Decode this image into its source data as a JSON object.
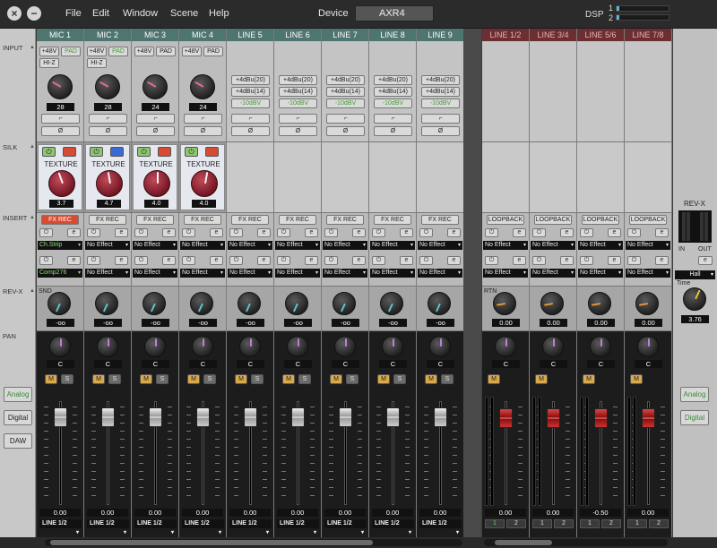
{
  "menu": [
    "File",
    "Edit",
    "Window",
    "Scene",
    "Help"
  ],
  "device": {
    "label": "Device",
    "value": "AXR4"
  },
  "dsp": {
    "label": "DSP",
    "rows": [
      {
        "num": "1",
        "fill": 0.05
      },
      {
        "num": "2",
        "fill": 0.05
      }
    ]
  },
  "sections": {
    "input": "INPUT",
    "silk": "SILK",
    "insert": "INSERT",
    "revx": "REV-X",
    "pan": "PAN"
  },
  "side_buttons": [
    "Analog",
    "Digital",
    "DAW"
  ],
  "right_buttons": [
    "Analog",
    "Digital"
  ],
  "colors": {
    "header_green": "#4e7570",
    "header_red": "#6b2e32",
    "fx_rec_active": "#d64b32",
    "mute_on": "#d9a94c"
  },
  "mic": [
    {
      "name": "MIC 1",
      "phantom": "+48V",
      "pad": "PAD",
      "hiz": "HI-Z",
      "gain": "28",
      "silk_tex": "TEXTURE",
      "silk_val": "3.7",
      "silk_blue": false,
      "fxrec": "FX REC",
      "fxrec_active": true,
      "fx1": "Ch.Strip",
      "fx2": "Comp276",
      "send": "-oo",
      "pan": "C",
      "out": "LINE 1/2"
    },
    {
      "name": "MIC 2",
      "phantom": "+48V",
      "pad": "PAD",
      "hiz": "HI-Z",
      "gain": "28",
      "silk_tex": "TEXTURE",
      "silk_val": "4.7",
      "silk_blue": true,
      "fxrec": "FX REC",
      "fxrec_active": false,
      "fx1": "No Effect",
      "fx2": "No Effect",
      "send": "-oo",
      "pan": "C",
      "out": "LINE 1/2"
    },
    {
      "name": "MIC 3",
      "phantom": "+48V",
      "pad": "PAD",
      "hiz": "",
      "gain": "24",
      "silk_tex": "TEXTURE",
      "silk_val": "4.0",
      "silk_blue": false,
      "fxrec": "FX REC",
      "fxrec_active": false,
      "fx1": "No Effect",
      "fx2": "No Effect",
      "send": "-oo",
      "pan": "C",
      "out": "LINE 1/2"
    },
    {
      "name": "MIC 4",
      "phantom": "+48V",
      "pad": "PAD",
      "hiz": "",
      "gain": "24",
      "silk_tex": "TEXTURE",
      "silk_val": "4.0",
      "silk_blue": false,
      "fxrec": "FX REC",
      "fxrec_active": false,
      "fx1": "No Effect",
      "fx2": "No Effect",
      "send": "-oo",
      "pan": "C",
      "out": "LINE 1/2"
    }
  ],
  "line": [
    {
      "name": "LINE 5",
      "lvl1": "+4dBu(20)",
      "lvl2": "+4dBu(14)",
      "lvl3": "-10dBV",
      "fxrec": "FX REC",
      "fx1": "No Effect",
      "fx2": "No Effect",
      "send": "-oo",
      "pan": "C",
      "out": "LINE 1/2"
    },
    {
      "name": "LINE 6",
      "lvl1": "+4dBu(20)",
      "lvl2": "+4dBu(14)",
      "lvl3": "-10dBV",
      "fxrec": "FX REC",
      "fx1": "No Effect",
      "fx2": "No Effect",
      "send": "-oo",
      "pan": "C",
      "out": "LINE 1/2"
    },
    {
      "name": "LINE 7",
      "lvl1": "+4dBu(20)",
      "lvl2": "+4dBu(14)",
      "lvl3": "-10dBV",
      "fxrec": "FX REC",
      "fx1": "No Effect",
      "fx2": "No Effect",
      "send": "-oo",
      "pan": "C",
      "out": "LINE 1/2"
    },
    {
      "name": "LINE 8",
      "lvl1": "+4dBu(20)",
      "lvl2": "+4dBu(14)",
      "lvl3": "-10dBV",
      "fxrec": "FX REC",
      "fx1": "No Effect",
      "fx2": "No Effect",
      "send": "-oo",
      "pan": "C",
      "out": "LINE 1/2"
    },
    {
      "name": "LINE 9",
      "lvl1": "+4dBu(20)",
      "lvl2": "+4dBu(14)",
      "lvl3": "-10dBV",
      "fxrec": "FX REC",
      "fx1": "No Effect",
      "fx2": "No Effect",
      "send": "-oo",
      "pan": "C",
      "out": "LINE 1/2"
    }
  ],
  "stereo": [
    {
      "name": "LINE 1/2",
      "loop": "LOOPBACK",
      "fx1": "No Effect",
      "fx2": "No Effect",
      "rtn": "0.00",
      "pan": "C",
      "fader": "0.00",
      "hp1": "1",
      "hp2": "2",
      "hp1_on": true
    },
    {
      "name": "LINE 3/4",
      "loop": "LOOPBACK",
      "fx1": "No Effect",
      "fx2": "No Effect",
      "rtn": "0.00",
      "pan": "C",
      "fader": "0.00",
      "hp1": "1",
      "hp2": "2",
      "hp1_on": false
    },
    {
      "name": "LINE 5/6",
      "loop": "LOOPBACK",
      "fx1": "No Effect",
      "fx2": "No Effect",
      "rtn": "0.00",
      "pan": "C",
      "fader": "-0.50",
      "hp1": "1",
      "hp2": "2",
      "hp1_on": false
    },
    {
      "name": "LINE 7/8",
      "loop": "LOOPBACK",
      "fx1": "No Effect",
      "fx2": "No Effect",
      "rtn": "0.00",
      "pan": "C",
      "fader": "0.00",
      "hp1": "1",
      "hp2": "2",
      "hp1_on": false
    }
  ],
  "mono_fader_value": "0.00",
  "mute": "M",
  "solo": "S",
  "snd_label": "SND",
  "rtn_label": "RTN",
  "revx": {
    "title": "REV-X",
    "in": "IN",
    "out": "OUT",
    "type": "Hall",
    "time_label": "Time",
    "time": "3.76"
  }
}
